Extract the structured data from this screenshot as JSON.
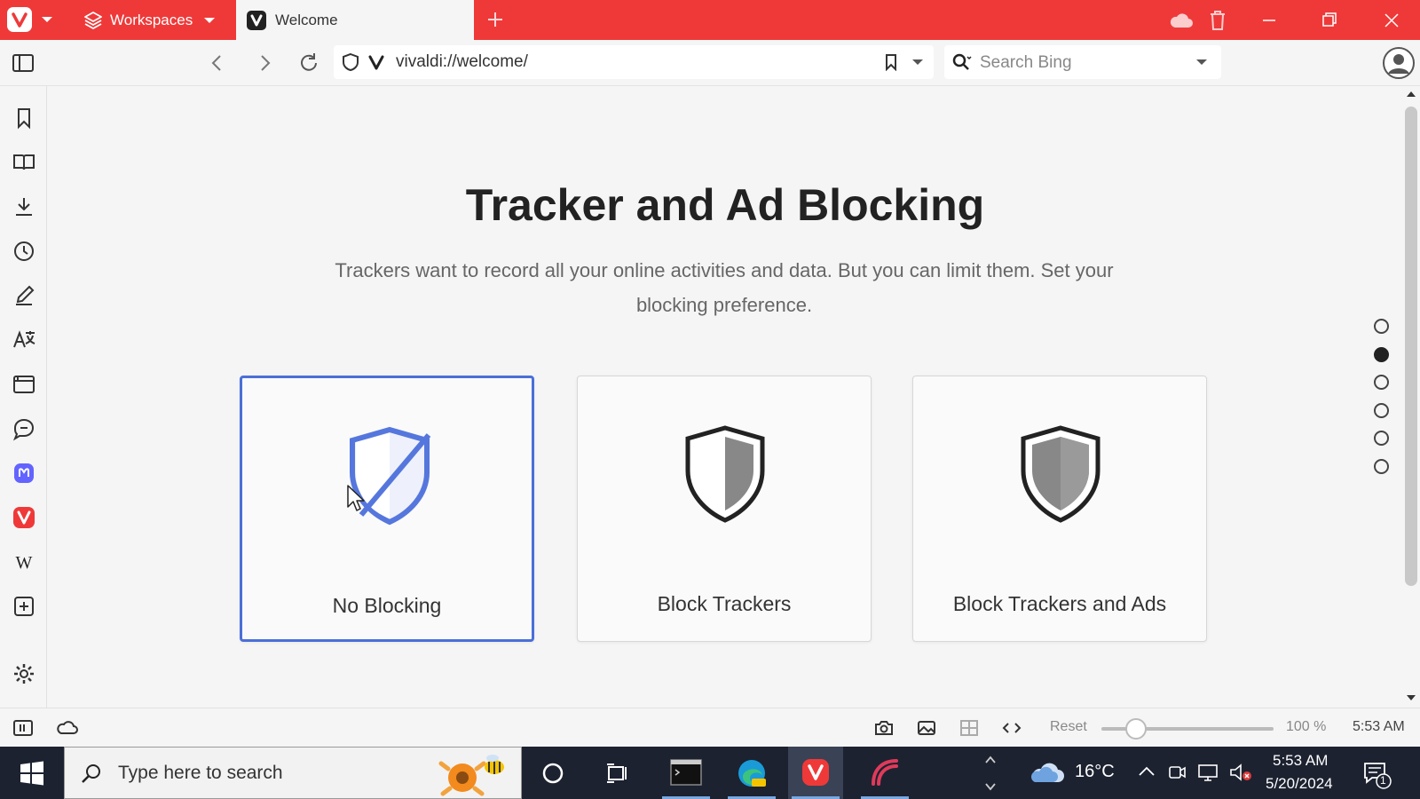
{
  "titlebar": {
    "workspaces_label": "Workspaces",
    "tab_title": "Welcome",
    "brand_color": "#ef3939"
  },
  "addressbar": {
    "url": "vivaldi://welcome/",
    "search_placeholder": "Search Bing"
  },
  "main": {
    "heading": "Tracker and Ad Blocking",
    "subtitle": "Trackers want to record all your online activities and data. But you can limit them. Set your blocking preference.",
    "options": [
      {
        "label": "No Blocking",
        "selected": true
      },
      {
        "label": "Block Trackers",
        "selected": false
      },
      {
        "label": "Block Trackers and Ads",
        "selected": false
      }
    ],
    "selected_color": "#4a6fd8",
    "page_dots_active": 2
  },
  "statusbar": {
    "reset_label": "Reset",
    "zoom_level": "100 %",
    "clock": "5:53 AM"
  },
  "taskbar": {
    "search_placeholder": "Type here to search",
    "temperature": "16°C",
    "time": "5:53 AM",
    "date": "5/20/2024",
    "notification_count": "1"
  }
}
